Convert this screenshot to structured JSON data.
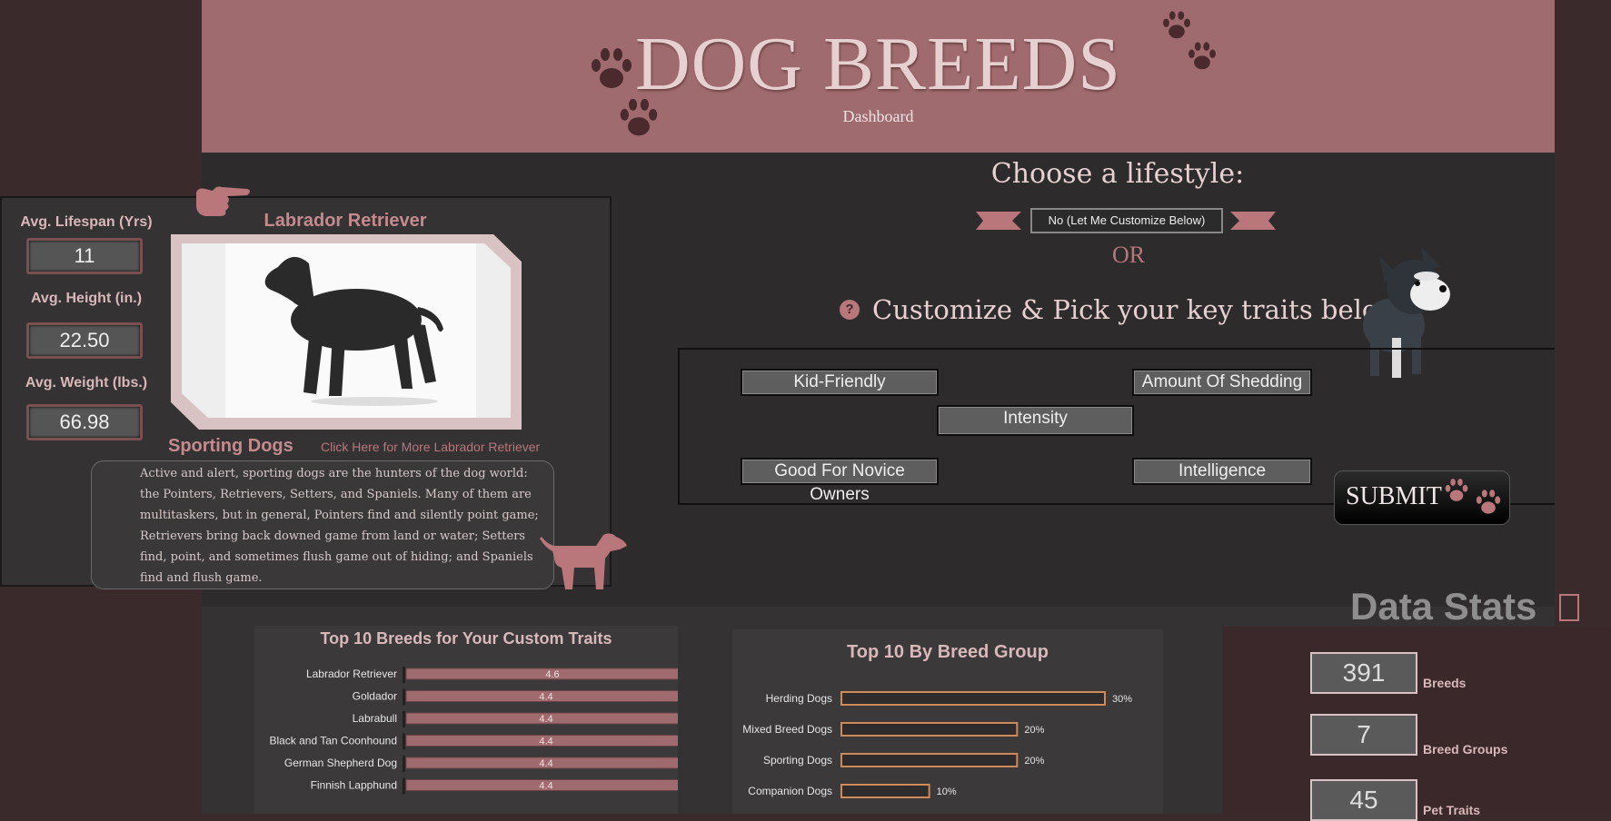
{
  "colors": {
    "accent": "#a06b6e",
    "pink_text": "#d9b8ba",
    "panel": "#2d2b2c",
    "side": "#3b2a2c"
  },
  "header": {
    "title": "DOG BREEDS",
    "subtitle": "Dashboard"
  },
  "stats": {
    "lifespan_label": "Avg. Lifespan (Yrs)",
    "lifespan_value": "11",
    "height_label": "Avg. Height (in.)",
    "height_value": "22.50",
    "weight_label": "Avg. Weight (lbs.)",
    "weight_value": "66.98"
  },
  "breed": {
    "name": "Labrador Retriever",
    "group": "Sporting Dogs",
    "more_link": "Click Here for More Labrador Retriever",
    "description": "Active and alert, sporting dogs are the hunters of the dog world: the Pointers, Retrievers, Setters, and Spaniels. Many of them are multitaskers, but in general, Pointers find and silently point game; Retrievers bring back downed game from land or water; Setters find, point, and sometimes flush game out of hiding; and Spaniels find and flush game."
  },
  "lifestyle": {
    "title": "Choose a lifestyle:",
    "selected": "No (Let Me Customize Below)",
    "or": "OR",
    "customize_title": "Customize & Pick your key traits below:",
    "help_glyph": "?"
  },
  "traits": {
    "kid_friendly": "Kid-Friendly",
    "shedding": "Amount Of Shedding",
    "intensity": "Intensity",
    "novice": "Good For Novice Owners",
    "intelligence": "Intelligence"
  },
  "submit_label": "SUBMIT",
  "chart_data": [
    {
      "type": "bar",
      "title": "Top 10 Breeds for Your Custom Traits",
      "categories": [
        "Labrador Retriever",
        "Goldador",
        "Labrabull",
        "Black and Tan Coonhound",
        "German Shepherd Dog",
        "Finnish Lapphund"
      ],
      "values": [
        4.6,
        4.4,
        4.4,
        4.4,
        4.4,
        4.4
      ],
      "xlim": [
        0,
        5
      ]
    },
    {
      "type": "bar",
      "title": "Top 10 By Breed Group",
      "categories": [
        "Herding Dogs",
        "Mixed Breed Dogs",
        "Sporting Dogs",
        "Companion Dogs"
      ],
      "values": [
        30,
        20,
        20,
        10
      ],
      "value_suffix": "%",
      "xlim": [
        0,
        30
      ]
    }
  ],
  "data_stats": {
    "title": "Data Stats",
    "breeds_value": "391",
    "breeds_label": "Breeds",
    "groups_value": "7",
    "groups_label": "Breed Groups",
    "traits_value": "45",
    "traits_label": "Pet Traits"
  }
}
